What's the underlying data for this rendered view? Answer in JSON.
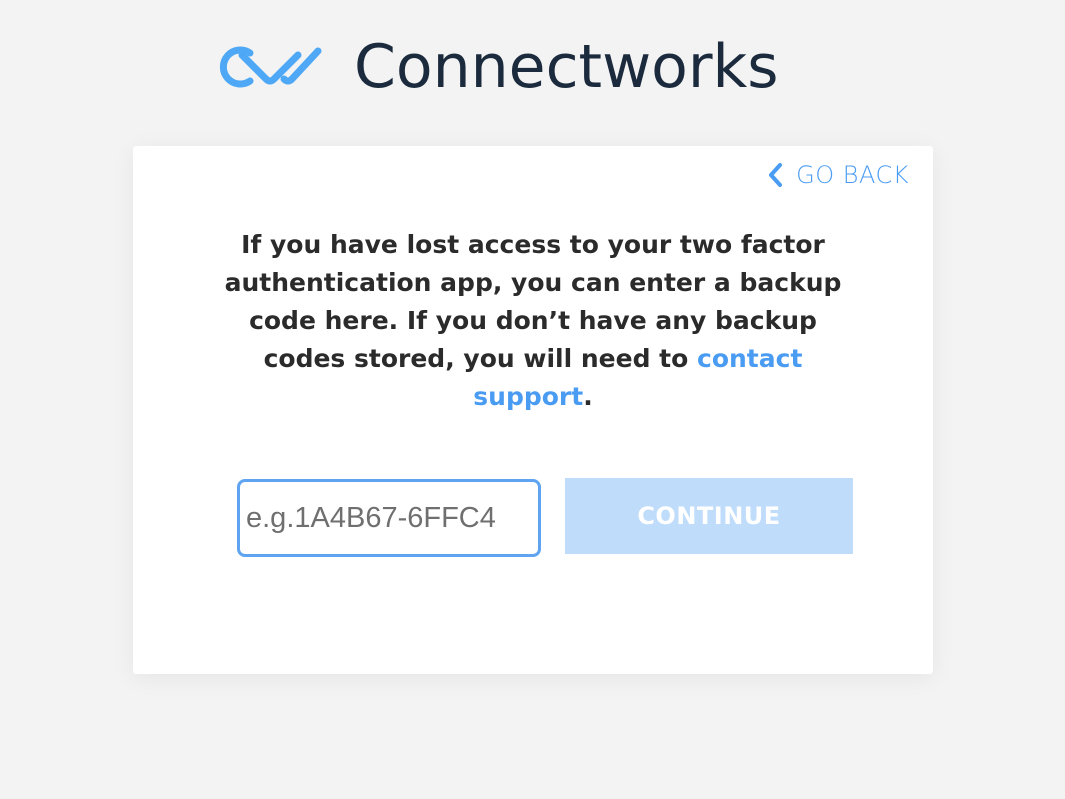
{
  "brand": {
    "name": "Connectworks",
    "mark_color": "#4fa8f5",
    "text_color": "#1b2a3d"
  },
  "card": {
    "go_back_label": "GO BACK",
    "message_part1": "If you have lost access to your two factor authentication app, you can enter a backup code here. If you don’t have any backup codes stored, you will need to ",
    "support_link": "contact support",
    "message_part2": ".",
    "code_input": {
      "value": "",
      "placeholder": "e.g.1A4B67-6FFC4"
    },
    "continue_label": "CONTINUE"
  },
  "colors": {
    "accent": "#4a9cf3",
    "button_disabled": "#c0dcfb",
    "background": "#f3f3f3"
  }
}
